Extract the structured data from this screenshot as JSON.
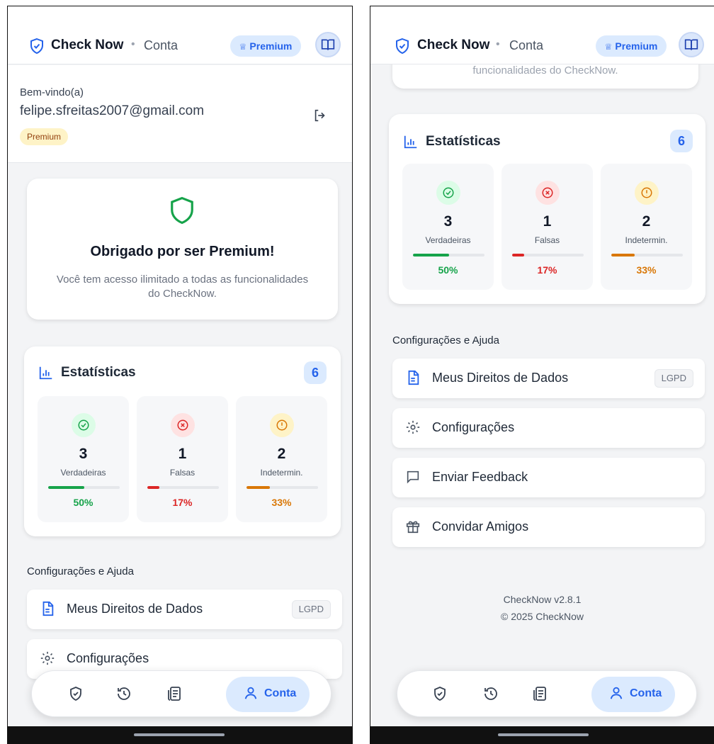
{
  "app": {
    "name": "Check Now",
    "dot": "•",
    "section": "Conta",
    "premium_pill": "Premium"
  },
  "welcome": {
    "label": "Bem-vindo(a)",
    "email": "felipe.sfreitas2007@gmail.com",
    "badge": "Premium"
  },
  "thanks": {
    "title": "Obrigado por ser Premium!",
    "subtitle": "Você tem acesso ilimitado a todas as funcionalidades do CheckNow.",
    "partial_text": "funcionalidades do CheckNow."
  },
  "stats": {
    "title": "Estatísticas",
    "total": "6",
    "items": [
      {
        "count": "3",
        "label": "Verdadeiras",
        "percent_text": "50%",
        "fraction": 0.5,
        "color": "#16a34a",
        "icon_bg": "#dcfce7",
        "icon": "check-circle-icon"
      },
      {
        "count": "1",
        "label": "Falsas",
        "percent_text": "17%",
        "fraction": 0.17,
        "color": "#dc2626",
        "icon_bg": "#fee2e2",
        "icon": "x-circle-icon"
      },
      {
        "count": "2",
        "label": "Indetermin.",
        "percent_text": "33%",
        "fraction": 0.33,
        "color": "#d97706",
        "icon_bg": "#fef3c7",
        "icon": "alert-circle-icon"
      }
    ]
  },
  "settings": {
    "title": "Configurações e Ajuda",
    "items": [
      {
        "label": "Meus Direitos de Dados",
        "tag": "LGPD",
        "icon": "document-icon"
      },
      {
        "label": "Configurações",
        "icon": "gear-icon"
      },
      {
        "label": "Enviar Feedback",
        "icon": "chat-icon"
      },
      {
        "label": "Convidar Amigos",
        "icon": "gift-icon"
      }
    ]
  },
  "footer": {
    "version": "CheckNow v2.8.1",
    "copyright": "© 2025 CheckNow"
  },
  "tabbar": {
    "active_label": "Conta"
  },
  "colors": {
    "accent": "#2563eb",
    "accent_bg": "#dbeafe",
    "premium_badge_bg": "#fef3c7",
    "shield_green": "#16a34a"
  }
}
